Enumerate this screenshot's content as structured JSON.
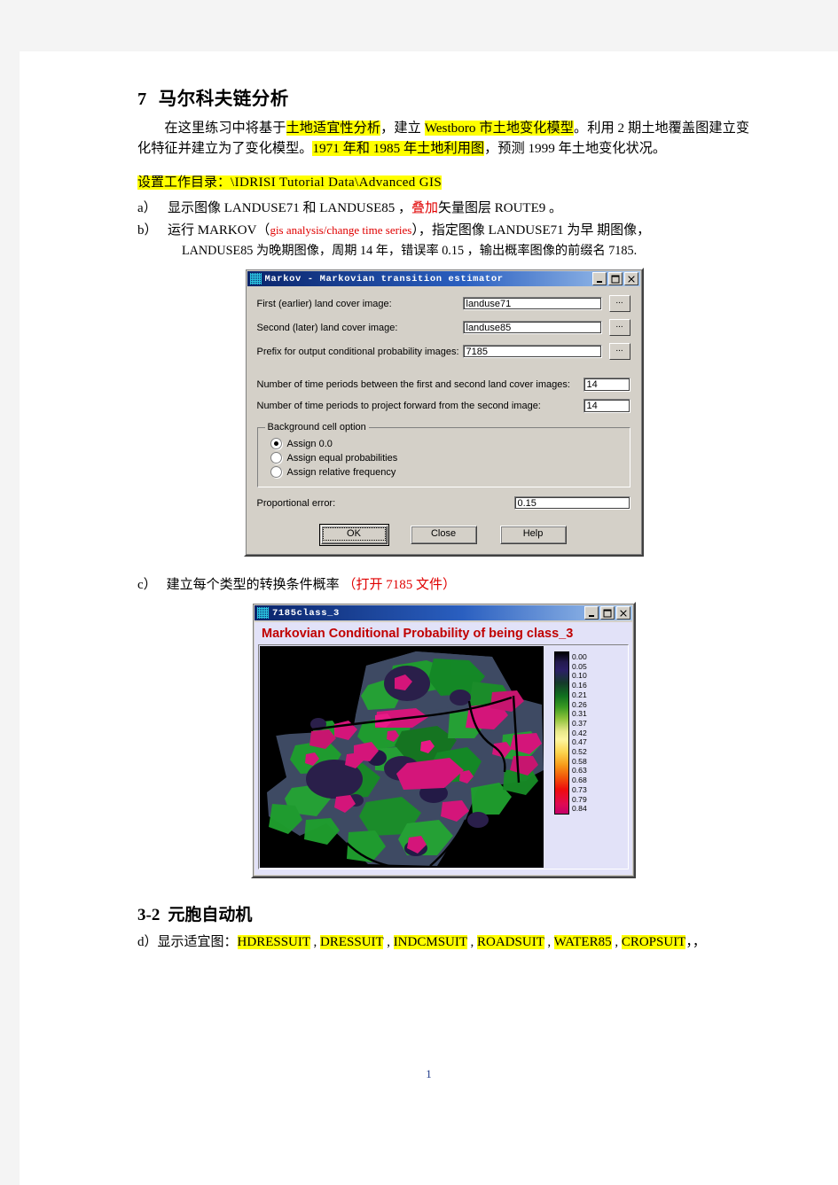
{
  "document": {
    "page_number": "1"
  },
  "section1": {
    "number": "7",
    "title": "马尔科夫链分析",
    "para_parts": {
      "p1": "在这里练习中将基于",
      "hl1": "土地适宜性分析",
      "p2": "，建立 ",
      "hl2": "Westboro 市土地变化模型",
      "p3": "。利用 2 期土地覆盖图建立变化特征并建立为了变化模型。",
      "hl3": "1971 年和 1985 年土地利用图",
      "p4": "，预测 1999 年土地变化状况。"
    },
    "path_label": "设置工作目录：",
    "path_value": "\\IDRISI Tutorial Data\\Advanced GIS",
    "steps": [
      {
        "marker": "a）",
        "t1": "显示图像 LANDUSE71  和 LANDUSE85 ，",
        "t2": "叠加",
        "t3": "矢量图层 ROUTE9 。"
      },
      {
        "marker": "b）",
        "t1": "运行 MARKOV（",
        "t2": "gis  analysis/change  time   series",
        "t3": "），指定图像 LANDUSE71 为早 期图像，",
        "sub1": "LANDUSE85 为晚期图像，周期 14 年，错误率 0.15  ，输出概率图像的前缀名 7185."
      }
    ],
    "step_c": {
      "marker": "c）",
      "text": "建立每个类型的转换条件概率 ",
      "note": "（打开 7185 文件）"
    }
  },
  "markov_dialog": {
    "title": "Markov - Markovian transition estimator",
    "icon": "app-grid-icon",
    "window_buttons": [
      "minimize",
      "maximize",
      "close"
    ],
    "fields": [
      {
        "label": "First (earlier) land cover image:",
        "value": "landuse71",
        "browse": "..."
      },
      {
        "label": "Second (later) land cover image:",
        "value": "landuse85",
        "browse": "..."
      },
      {
        "label": "Prefix for output conditional probability images:",
        "value": "7185",
        "browse": "..."
      }
    ],
    "numbers": [
      {
        "label": "Number of time periods between the first and second land cover images:",
        "value": "14"
      },
      {
        "label": "Number of time periods to project forward from the second image:",
        "value": "14"
      }
    ],
    "group": {
      "legend": "Background cell option",
      "options": [
        {
          "label": "Assign 0.0",
          "selected": true
        },
        {
          "label": "Assign equal probabilities",
          "selected": false
        },
        {
          "label": "Assign relative frequency",
          "selected": false
        }
      ]
    },
    "error": {
      "label": "Proportional error:",
      "value": "0.15"
    },
    "buttons": {
      "ok": "OK",
      "close": "Close",
      "help": "Help"
    }
  },
  "map_window": {
    "title": "7185class_3",
    "icon": "app-grid-icon",
    "heading": "Markovian Conditional Probability of being class_3",
    "legend_values": [
      "0.00",
      "0.05",
      "0.10",
      "0.16",
      "0.21",
      "0.26",
      "0.31",
      "0.37",
      "0.42",
      "0.47",
      "0.52",
      "0.58",
      "0.63",
      "0.68",
      "0.73",
      "0.79",
      "0.84"
    ],
    "colors": {
      "background": "#000000",
      "slate": "#3e4a63",
      "green": "#1f9e2e",
      "dark_green": "#146b22",
      "purple": "#2a1f4a",
      "magenta": "#d4157a"
    }
  },
  "section2": {
    "number": "3-2",
    "title": "元胞自动机",
    "step_d": {
      "marker": "d）",
      "prefix": "显示适宜图：",
      "items": [
        "HDRESSUIT",
        "DRESSUIT",
        "INDCMSUIT",
        "ROADSUIT",
        "WATER85",
        "CROPSUIT"
      ],
      "suffix": "，，"
    }
  }
}
